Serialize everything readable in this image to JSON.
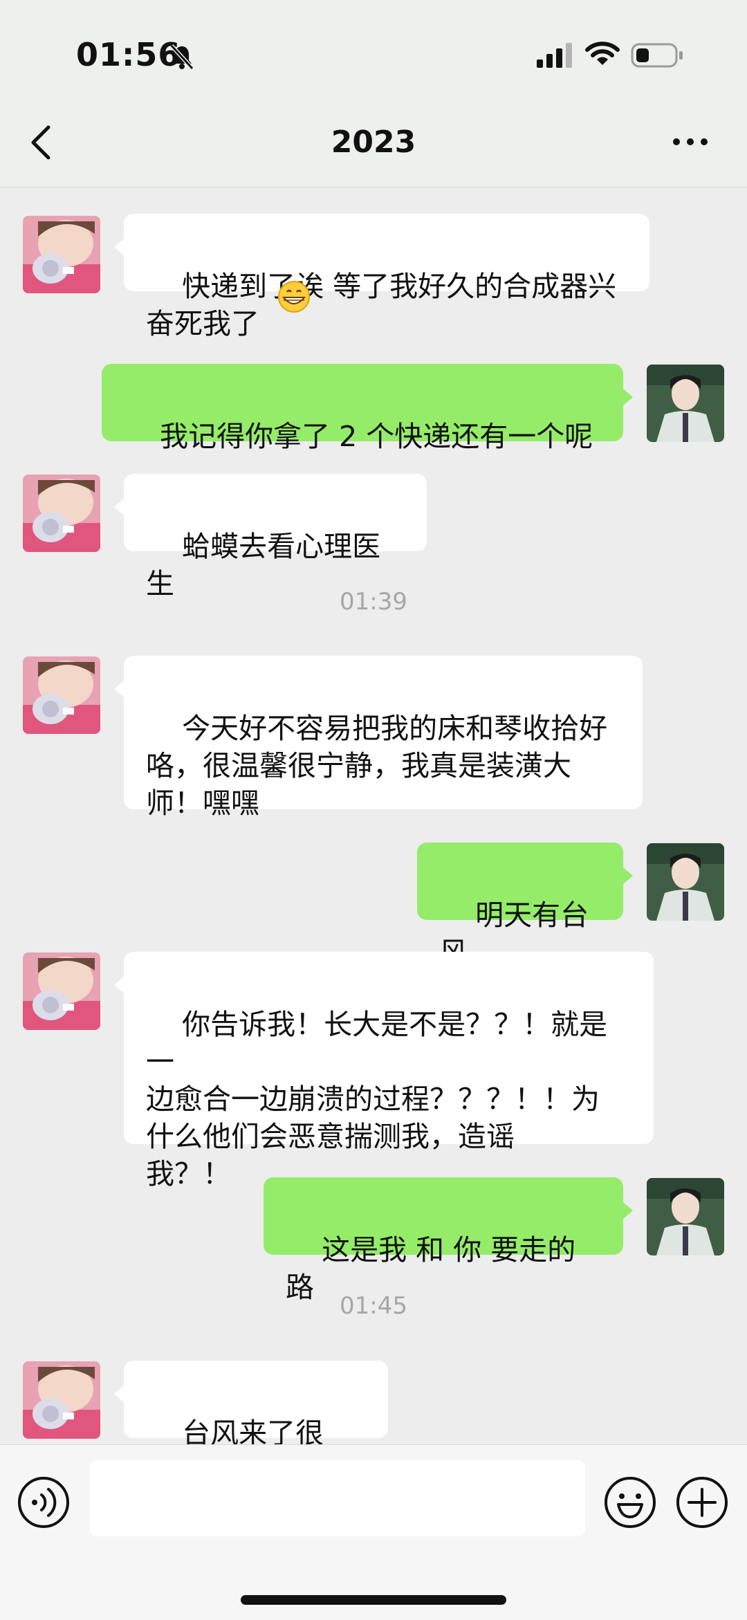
{
  "status_bar": {
    "time": "01:56"
  },
  "nav": {
    "title": "2023"
  },
  "messages": [
    {
      "side": "in",
      "text": "快递到了诶 等了我好久的合成器兴\n奋死我了",
      "emoji": "grinning-face"
    },
    {
      "side": "out",
      "text": "我记得你拿了 2 个快递还有一个呢"
    },
    {
      "side": "in",
      "text": "蛤蟆去看心理医生"
    },
    {
      "timestamp": "01:39"
    },
    {
      "side": "in",
      "text": "今天好不容易把我的床和琴收拾好\n咯，很温馨很宁静，我真是装潢大\n师！嘿嘿"
    },
    {
      "side": "out",
      "text": "明天有台风"
    },
    {
      "side": "in",
      "text": "你告诉我！长大是不是？？！就是一\n边愈合一边崩溃的过程？？？！！为\n什么他们会恶意揣测我，造谣\n我？！"
    },
    {
      "side": "out",
      "text": "这是我 和 你 要走的路"
    },
    {
      "timestamp": "01:45"
    },
    {
      "side": "in",
      "text": "台风来了很久..."
    }
  ],
  "colors": {
    "incoming_bubble": "#ffffff",
    "outgoing_bubble": "#95ec69",
    "background": "#ededed"
  },
  "input": {
    "placeholder": ""
  }
}
